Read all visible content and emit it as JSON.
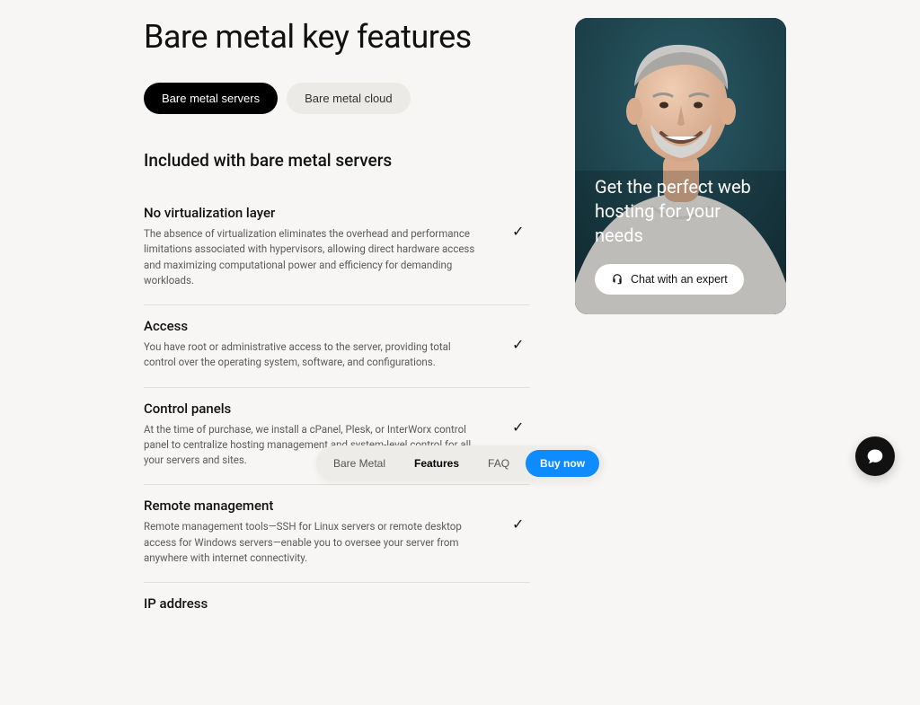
{
  "header": {
    "title": "Bare metal key features"
  },
  "tabs": {
    "servers": "Bare metal servers",
    "cloud": "Bare metal cloud"
  },
  "subheading": "Included with bare metal servers",
  "features": [
    {
      "title": "No virtualization layer",
      "desc": "The absence of virtualization eliminates the overhead and performance limitations associated with hypervisors, allowing direct hardware access and maximizing computational power and efficiency for demanding workloads."
    },
    {
      "title": "Access",
      "desc": "You have root or administrative access to the server, providing total control over the operating system, software, and configurations."
    },
    {
      "title": "Control panels",
      "desc": "At the time of purchase, we install a cPanel, Plesk, or InterWorx control panel to centralize hosting management and system-level control for all your servers and sites."
    },
    {
      "title": "Remote management",
      "desc": "Remote management tools—SSH for Linux servers or remote desktop access for Windows servers—enable you to oversee your server from anywhere with internet connectivity."
    },
    {
      "title": "IP address",
      "desc": ""
    }
  ],
  "promo": {
    "title": "Get the perfect web hosting for your needs",
    "cta": "Chat with an expert"
  },
  "bottom_nav": {
    "bare_metal": "Bare Metal",
    "features": "Features",
    "faq": "FAQ",
    "buy": "Buy now"
  }
}
